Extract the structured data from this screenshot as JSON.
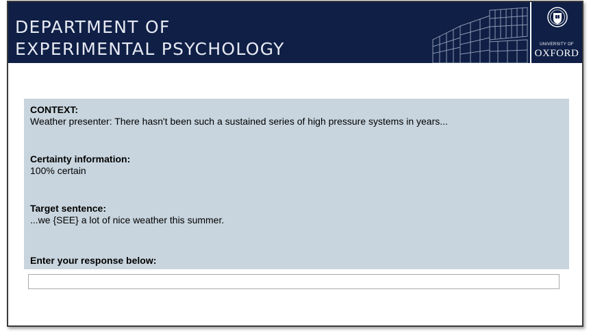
{
  "header": {
    "title_line1": "DEPARTMENT OF",
    "title_line2": "EXPERIMENTAL PSYCHOLOGY",
    "logo": {
      "small_text": "UNIVERSITY OF",
      "big_text": "OXFORD",
      "icon": "university-crest-icon"
    },
    "building_icon": "building-illustration-icon"
  },
  "trial": {
    "context_label": "CONTEXT:",
    "context_text": "Weather presenter: There hasn't been such a sustained series of high pressure systems in years...",
    "certainty_label": "Certainty information:",
    "certainty_text": "100% certain",
    "target_label": "Target sentence:",
    "target_text": "...we {SEE} a lot of nice weather this summer.",
    "response_prompt": "Enter your response below:"
  },
  "response": {
    "value": "",
    "placeholder": ""
  },
  "colors": {
    "header_bg": "#0f1f46",
    "panel_bg": "#c8d5de"
  }
}
